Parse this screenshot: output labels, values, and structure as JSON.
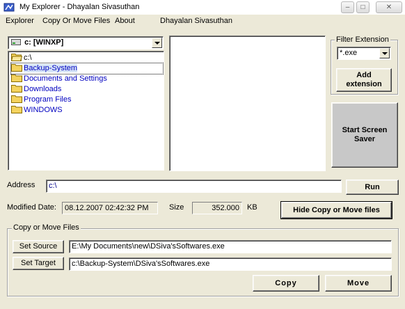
{
  "window": {
    "title": "My Explorer - Dhayalan Sivasuthan",
    "minimize_glyph": "–",
    "maximize_glyph": "□",
    "close_glyph": "✕",
    "icon": "app-icon"
  },
  "menu": {
    "items": [
      "Explorer",
      "Copy Or Move Files",
      "About"
    ],
    "author": "Dhayalan Sivasuthan"
  },
  "drive": {
    "selected": "c: [WINXP]",
    "icon": "drive-icon"
  },
  "tree": {
    "items": [
      {
        "label": "c:\\",
        "icon": "open-folder-icon"
      },
      {
        "label": "Backup-System",
        "icon": "folder-icon",
        "selected": true
      },
      {
        "label": "Documents and Settings",
        "icon": "folder-icon"
      },
      {
        "label": "Downloads",
        "icon": "folder-icon"
      },
      {
        "label": "Program Files",
        "icon": "folder-icon"
      },
      {
        "label": "WINDOWS",
        "icon": "folder-icon"
      }
    ]
  },
  "filter": {
    "group_label": "Filter Extension",
    "selected": "*.exe",
    "add_label": "Add extension"
  },
  "screensaver": {
    "label": "Start Screen Saver"
  },
  "address": {
    "label": "Address",
    "value": "c:\\",
    "run_label": "Run"
  },
  "info": {
    "modified_label": "Modified Date:",
    "modified_value": "08.12.2007 02:42:32 PM",
    "size_label": "Size",
    "size_value": "352.000",
    "size_unit": "KB",
    "hide_label": "Hide Copy or Move files"
  },
  "copy_move": {
    "group_label": "Copy or Move Files",
    "set_source_label": "Set Source",
    "source_value": "E:\\My Documents\\new\\DSiva'sSoftwares.exe",
    "set_target_label": "Set Target",
    "target_value": "c:\\Backup-System\\DSiva'sSoftwares.exe",
    "copy_label": "Copy",
    "move_label": "Move"
  },
  "colors": {
    "face": "#ece9d8",
    "tree_text": "#0000c0",
    "folder": "#f4d35e",
    "selection_bg": "#d6e4f7",
    "screensaver_face": "#c8c8c8"
  }
}
